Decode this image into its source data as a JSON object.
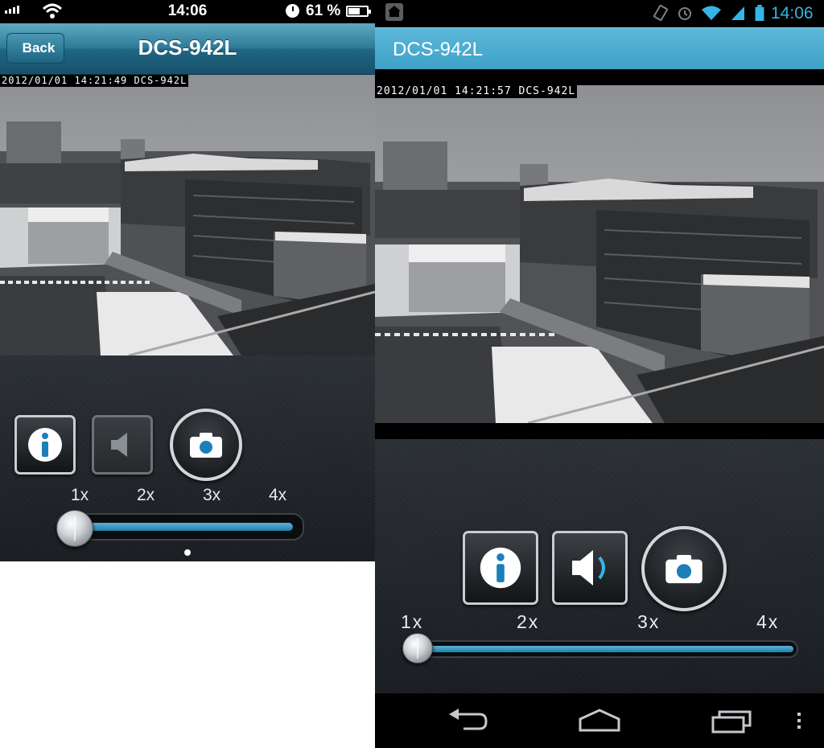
{
  "ios": {
    "status": {
      "time": "14:06",
      "battery": "61 %"
    },
    "nav": {
      "back_label": "Back",
      "title": "DCS-942L"
    },
    "feed": {
      "timestamp": "2012/01/01 14:21:49 DCS-942L"
    },
    "zoom": {
      "labels": [
        "1x",
        "2x",
        "3x",
        "4x"
      ],
      "level": "1x"
    },
    "buttons": {
      "info": "info-icon",
      "audio": "speaker-icon",
      "snapshot": "camera-icon"
    }
  },
  "android": {
    "status": {
      "time": "14:06"
    },
    "bar": {
      "title": "DCS-942L"
    },
    "feed": {
      "timestamp": "2012/01/01 14:21:57 DCS-942L"
    },
    "zoom": {
      "labels": [
        "1x",
        "2x",
        "3x",
        "4x"
      ],
      "level": "1x"
    },
    "buttons": {
      "info": "info-icon",
      "audio": "speaker-icon",
      "snapshot": "camera-icon"
    },
    "nav_icons": [
      "back-icon",
      "home-icon",
      "recent-apps-icon",
      "overflow-menu-icon"
    ]
  },
  "colors": {
    "ios_nav": "#2e7b98",
    "android_accent": "#35b5e5",
    "slider_fill": "#2a8fb9"
  }
}
